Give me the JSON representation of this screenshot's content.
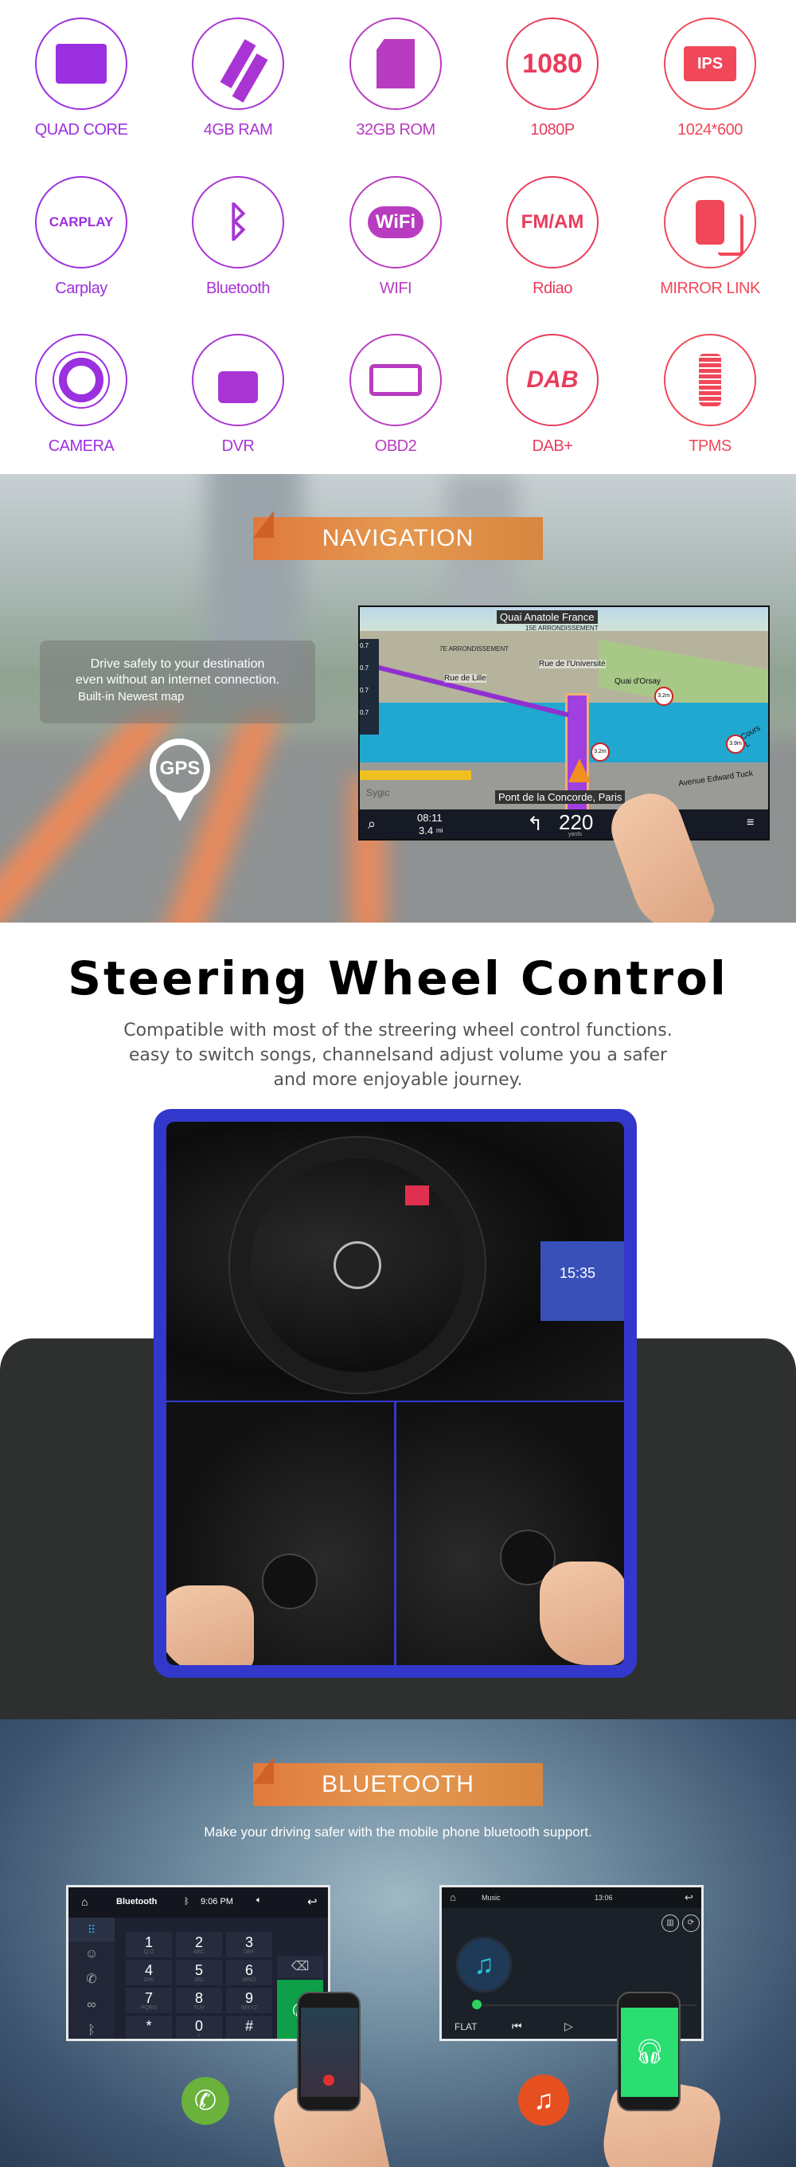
{
  "features": {
    "items": [
      {
        "label": "QUAD CORE",
        "icon": "cpu-icon",
        "color": "#9b30e0"
      },
      {
        "label": "4GB RAM",
        "icon": "ram-icon",
        "color": "#a834d4"
      },
      {
        "label": "32GB ROM",
        "icon": "sd-card-icon",
        "color": "#b83cc0"
      },
      {
        "label": "1080P",
        "icon": "1080-icon",
        "icon_text": "1080",
        "color": "#e83c5c"
      },
      {
        "label": "1024*600",
        "icon": "ips-screen-icon",
        "icon_text": "IPS",
        "color": "#f04858"
      },
      {
        "label": "Carplay",
        "icon": "carplay-icon",
        "icon_text": "CARPLAY",
        "color": "#9b30e0"
      },
      {
        "label": "Bluetooth",
        "icon": "bluetooth-icon",
        "icon_text": "ᛒ",
        "color": "#a834d4"
      },
      {
        "label": "WIFI",
        "icon": "wifi-icon",
        "icon_text": "WiFi",
        "color": "#b83cc0"
      },
      {
        "label": "Rdiao",
        "icon": "radio-icon",
        "icon_text": "FM/AM",
        "color": "#e83c5c"
      },
      {
        "label": "MIRROR LINK",
        "icon": "mirror-link-icon",
        "color": "#f04858"
      },
      {
        "label": "CAMERA",
        "icon": "camera-lens-icon",
        "color": "#9b30e0"
      },
      {
        "label": "DVR",
        "icon": "video-camera-icon",
        "color": "#a834d4"
      },
      {
        "label": "OBD2",
        "icon": "engine-icon",
        "color": "#b83cc0"
      },
      {
        "label": "DAB+",
        "icon": "dab-icon",
        "icon_text": "DAB",
        "color": "#e83c5c"
      },
      {
        "label": "TPMS",
        "icon": "tire-pressure-icon",
        "color": "#f04858"
      }
    ]
  },
  "navigation": {
    "banner": "NAVIGATION",
    "blurb_lines": [
      "Drive safely to your destination",
      "even without an internet connection."
    ],
    "blurb_sub": "Built-in Newest map",
    "gps_label": "GPS",
    "map": {
      "top_street": "Quai Anatole France",
      "district_1": "15E ARRONDISSEMENT",
      "district_2": "7E ARRONDISSEMENT",
      "street_1": "Rue de Lille",
      "street_2": "Rue de l'Université",
      "street_3": "Quai d'Orsay",
      "street_4": "Avenue Edward Tuck",
      "street_5": "Cours L",
      "poi_distance": "0.7",
      "limit_1": "3.2m",
      "limit_2": "3.9m",
      "brand": "Sygic",
      "current_road": "Pont de la Concorde, Paris",
      "eta_time": "08:11",
      "remaining": "3.4",
      "remaining_unit": "mi",
      "next_turn_distance": "220",
      "next_turn_unit": "yards"
    }
  },
  "steering": {
    "title": "Steering  Wheel  Control",
    "description": "Compatible with most of the streering wheel control functions. easy to switch songs, channelsand adjust volume you a safer and more enjoyable journey.",
    "head_unit_time": "15:35",
    "frame_color": "#3338cc"
  },
  "bluetooth": {
    "banner": "BLUETOOTH",
    "subtitle": "Make your driving safer with the mobile phone bluetooth support.",
    "dialer": {
      "title": "Bluetooth",
      "time": "9:06 PM",
      "keys": [
        {
          "d": "1",
          "s": "Q.O"
        },
        {
          "d": "2",
          "s": "ABC"
        },
        {
          "d": "3",
          "s": "DEF"
        },
        {
          "d": "4",
          "s": "GHI"
        },
        {
          "d": "5",
          "s": "JKL"
        },
        {
          "d": "6",
          "s": "MNO"
        },
        {
          "d": "7",
          "s": "PQRS"
        },
        {
          "d": "8",
          "s": "TUV"
        },
        {
          "d": "9",
          "s": "WXYZ"
        },
        {
          "d": "*",
          "s": ""
        },
        {
          "d": "0",
          "s": "+"
        },
        {
          "d": "#",
          "s": ""
        }
      ]
    },
    "music": {
      "title": "Music",
      "time": "13:06",
      "eq_label": "FLAT",
      "progress": 0
    }
  }
}
